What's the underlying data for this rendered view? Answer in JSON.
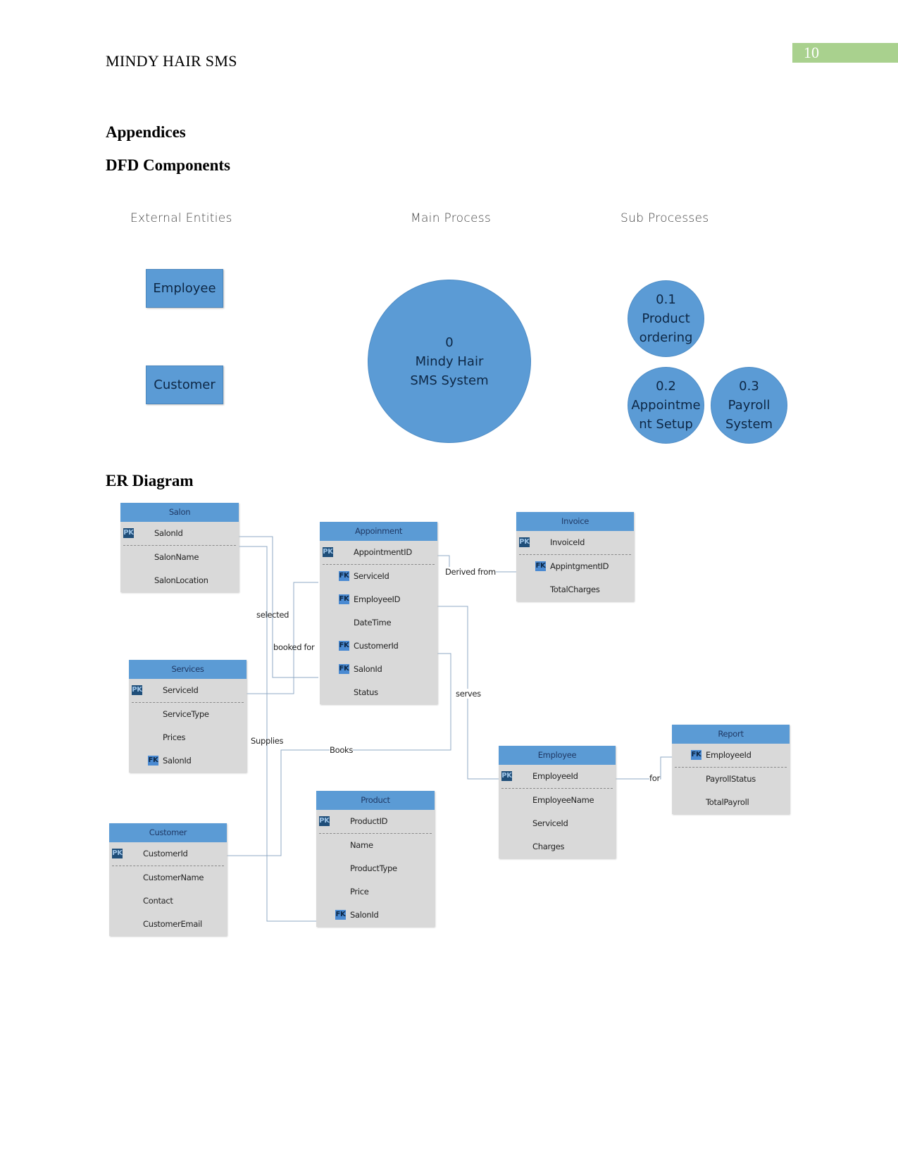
{
  "header": {
    "running_head": "MINDY HAIR SMS",
    "page_number": "10",
    "page_number_color": "#a9d18e"
  },
  "sections": {
    "appendices": "Appendices",
    "dfd_title": "DFD Components",
    "er_title": "ER Diagram"
  },
  "dfd": {
    "columns": [
      "External Entities",
      "Main Process",
      "Sub Processes"
    ],
    "external_entities": [
      "Employee",
      "Customer"
    ],
    "main_process": {
      "number": "0",
      "lines": [
        "Mindy Hair",
        "SMS System"
      ]
    },
    "sub_processes": [
      {
        "number": "0.1",
        "lines": [
          "Product",
          "ordering"
        ]
      },
      {
        "number": "0.2",
        "lines": [
          "Appointme",
          "nt Setup"
        ]
      },
      {
        "number": "0.3",
        "lines": [
          "Payroll",
          "System"
        ]
      }
    ],
    "fill_color": "#5b9bd5"
  },
  "er": {
    "entities": {
      "salon": {
        "title": "Salon",
        "pk": {
          "key": "PK",
          "name": "SalonId"
        },
        "attrs": [
          {
            "key": "",
            "name": "SalonName"
          },
          {
            "key": "",
            "name": "SalonLocation"
          }
        ]
      },
      "appointment": {
        "title": "Appoinment",
        "pk": {
          "key": "PK",
          "name": "AppointmentID"
        },
        "attrs": [
          {
            "key": "FK",
            "name": "ServiceId"
          },
          {
            "key": "FK",
            "name": "EmployeeID"
          },
          {
            "key": "",
            "name": "DateTime"
          },
          {
            "key": "FK",
            "name": "CustomerId"
          },
          {
            "key": "FK",
            "name": "SalonId"
          },
          {
            "key": "",
            "name": "Status"
          }
        ]
      },
      "invoice": {
        "title": "Invoice",
        "pk": {
          "key": "PK",
          "name": "InvoiceId"
        },
        "attrs": [
          {
            "key": "FK",
            "name": "AppintgmentID"
          },
          {
            "key": "",
            "name": "TotalCharges"
          }
        ]
      },
      "services": {
        "title": "Services",
        "pk": {
          "key": "PK",
          "name": "ServiceId"
        },
        "attrs": [
          {
            "key": "",
            "name": "ServiceType"
          },
          {
            "key": "",
            "name": "Prices"
          },
          {
            "key": "FK",
            "name": "SalonId"
          }
        ]
      },
      "employee": {
        "title": "Employee",
        "pk": {
          "key": "PK",
          "name": "EmployeeId"
        },
        "attrs": [
          {
            "key": "",
            "name": "EmployeeName"
          },
          {
            "key": "",
            "name": "ServiceId"
          },
          {
            "key": "",
            "name": "Charges"
          }
        ]
      },
      "report": {
        "title": "Report",
        "pk": {
          "key": "FK",
          "name": "EmployeeId"
        },
        "attrs": [
          {
            "key": "",
            "name": "PayrollStatus"
          },
          {
            "key": "",
            "name": "TotalPayroll"
          }
        ]
      },
      "product": {
        "title": "Product",
        "pk": {
          "key": "PK",
          "name": "ProductID"
        },
        "attrs": [
          {
            "key": "",
            "name": "Name"
          },
          {
            "key": "",
            "name": "ProductType"
          },
          {
            "key": "",
            "name": "Price"
          },
          {
            "key": "FK",
            "name": "SalonId"
          }
        ]
      },
      "customer": {
        "title": "Customer",
        "pk": {
          "key": "PK",
          "name": "CustomerId"
        },
        "attrs": [
          {
            "key": "",
            "name": "CustomerName"
          },
          {
            "key": "",
            "name": "Contact"
          },
          {
            "key": "",
            "name": "CustomerEmail"
          }
        ]
      }
    },
    "relationships": {
      "selected": "selected",
      "booked_for": "booked for",
      "derived_from": "Derived from",
      "serves": "serves",
      "supplies": "Supplies",
      "books": "Books",
      "for": "for"
    }
  }
}
